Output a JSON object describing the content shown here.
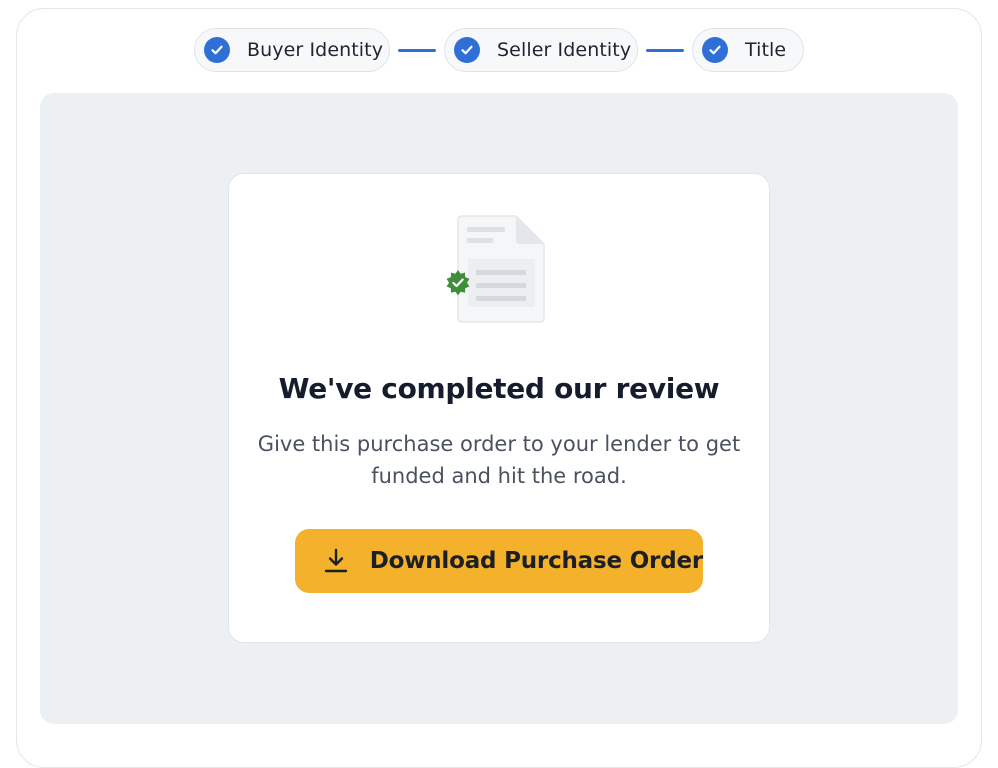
{
  "stepper": {
    "steps": [
      {
        "label": "Buyer Identity",
        "status": "complete",
        "icon": "check-circle-icon"
      },
      {
        "label": "Seller Identity",
        "status": "complete",
        "icon": "check-circle-icon"
      },
      {
        "label": "Title",
        "status": "complete",
        "icon": "check-circle-icon"
      }
    ]
  },
  "review": {
    "illustration": "document-verified-icon",
    "title": "We've completed our review",
    "description": "Give this purchase order to your lender to get funded and hit the road.",
    "download_button": {
      "label": "Download Purchase Order",
      "icon": "download-icon"
    }
  },
  "colors": {
    "accent_blue": "#2f6fd6",
    "button_yellow": "#f3b12c",
    "verified_green": "#3f8f3a",
    "panel_gray": "#edf0f3"
  }
}
